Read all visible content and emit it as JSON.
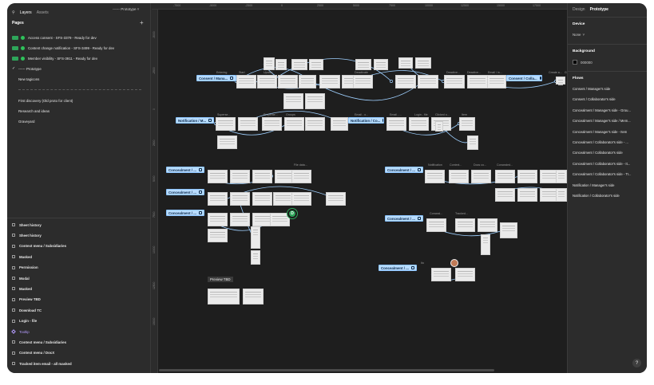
{
  "left_panel": {
    "tab_layers": "Layers",
    "tab_assets": "Assets",
    "prototype_menu": "------ Prototype",
    "pages_heading": "Pages",
    "add_page": "+",
    "pages": [
      {
        "badge": true,
        "label": "Access consent - SFS-3379 - Ready for dev"
      },
      {
        "badge": true,
        "label": "Content change notification - SFS-3499 - Ready for dev"
      },
      {
        "badge": true,
        "label": "Member visibility - SFS-3911 - Ready for dev"
      },
      {
        "check": true,
        "label": "------ Prototype"
      },
      {
        "label": "New tagicons"
      },
      {
        "label": "First discovery (Old proto for client)"
      },
      {
        "label": "Research and ideas"
      },
      {
        "label": "Graveyard"
      }
    ],
    "layers": [
      {
        "label": "Sheet history"
      },
      {
        "label": "Sheet history"
      },
      {
        "label": "Context menu / Subsidiaries"
      },
      {
        "label": "Masked"
      },
      {
        "label": "Permission"
      },
      {
        "label": "Modal"
      },
      {
        "label": "Masked"
      },
      {
        "label": "Preview TBD"
      },
      {
        "label": "Download TC"
      },
      {
        "label": "Login - file"
      },
      {
        "label": "Tooltip",
        "purple": true
      },
      {
        "label": "Context menu / Subsidiaries"
      },
      {
        "label": "Context menu / DocX"
      },
      {
        "label": "Tracked item email - all masked"
      }
    ]
  },
  "canvas": {
    "ruler_top": [
      "-7500",
      "-5000",
      "-2500",
      "0",
      "2500",
      "5000",
      "7500",
      "10000",
      "12500",
      "15000",
      "17500"
    ],
    "ruler_left": [
      "-5000",
      "-2500",
      "0",
      "2500",
      "5000",
      "7500",
      "10000",
      "12500",
      "15000"
    ],
    "flow_tags": [
      {
        "label": "Consent / Mana..."
      },
      {
        "label": "Consent / Colla..."
      },
      {
        "label": "Notification / M..."
      },
      {
        "label": "Notification / Co..."
      },
      {
        "label": "Concealment / ..."
      },
      {
        "label": "Concealment / ..."
      },
      {
        "label": "Concealment / ..."
      },
      {
        "label": "Concealment / ..."
      },
      {
        "label": "Concealment / ..."
      },
      {
        "label": "Concealment / ..."
      }
    ],
    "node_labels": [
      "Entering",
      "Start",
      "Update",
      "Deactivate",
      "Deactive...",
      "Deactive...",
      "Email / in...",
      "Create a...",
      "Groups",
      "Superse...",
      "Propertie...",
      "Groups",
      "Email - o...",
      "Email - ...",
      "Login - file",
      "Clicked o...",
      "Item",
      "File data...",
      "Notification",
      "Context...",
      "Docs co...",
      "Concealed...",
      "Conceal...",
      "Tracked...",
      "Ito"
    ],
    "cursor_initial": "D",
    "preview_label": "Preview TBD"
  },
  "right_panel": {
    "tab_design": "Design",
    "tab_prototype": "Prototype",
    "device_heading": "Device",
    "device_value": "None",
    "background_heading": "Background",
    "background_value": "000000",
    "background_color": "#000000",
    "flows_heading": "Flows",
    "flows": [
      "Consent / Manager's side",
      "Consent / Collaborator's side",
      "Concealment / Manager's side - Grou...",
      "Concealment / Manager's side / Mem...",
      "Concealment / Manager's side - Item",
      "Concealment / Collaborator's side - ...",
      "Concealment / Collaborator's side",
      "Concealment / Collaborator's side - It...",
      "Concealment / Collaborator's side - Tr...",
      "Notification / Manager's side",
      "Notification / Collaborator's side"
    ],
    "help": "?"
  },
  "colors": {
    "panel": "#2c2c2c",
    "canvas": "#1e1e1e",
    "wire": "#9fd0ff",
    "flow_tag": "#b8dcff",
    "ready_badge": "#2ea55a"
  }
}
